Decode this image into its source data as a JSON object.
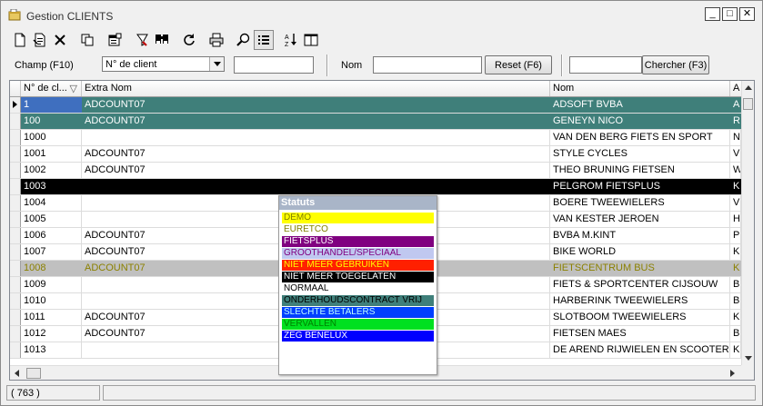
{
  "window": {
    "title": "Gestion CLIENTS",
    "controls": [
      "_",
      "□",
      "✕"
    ]
  },
  "toolbar": {
    "icons": [
      "new-document-icon",
      "edit-document-icon",
      "delete-icon",
      "copy-icon",
      "properties-icon",
      "filter-icon",
      "find-icon",
      "refresh-icon",
      "print-icon",
      "zoom-icon",
      "list-view-icon",
      "sort-icon",
      "columns-icon"
    ]
  },
  "search": {
    "champ_label": "Champ (F10)",
    "champ_value": "N° de client",
    "champ_input": "",
    "nom_label": "Nom",
    "nom_input": "",
    "reset_label": "Reset (F6)",
    "chercher_input": "",
    "chercher_label": "Chercher (F3)"
  },
  "grid": {
    "headers": [
      "N° de cl...",
      "Extra Nom",
      "Nom",
      "A"
    ],
    "sort_indicator": "▽",
    "rows": [
      {
        "num": "1",
        "extra": "ADCOUNT07",
        "nom": "ADSOFT BVBA",
        "a": "A",
        "style": "teal",
        "current": true
      },
      {
        "num": "100",
        "extra": "ADCOUNT07",
        "nom": "GENEYN NICO",
        "a": "R",
        "style": "teal",
        "current": false
      },
      {
        "num": "1000",
        "extra": "",
        "nom": "VAN DEN BERG FIETS EN SPORT",
        "a": "N",
        "style": "",
        "current": false
      },
      {
        "num": "1001",
        "extra": "ADCOUNT07",
        "nom": "STYLE CYCLES",
        "a": "V",
        "style": "",
        "current": false
      },
      {
        "num": "1002",
        "extra": "ADCOUNT07",
        "nom": "THEO BRUNING FIETSEN",
        "a": "W",
        "style": "",
        "current": false
      },
      {
        "num": "1003",
        "extra": "",
        "nom": "PELGROM FIETSPLUS",
        "a": "K",
        "style": "black",
        "current": false
      },
      {
        "num": "1004",
        "extra": "",
        "nom": "BOERE TWEEWIELERS",
        "a": "V",
        "style": "",
        "current": false
      },
      {
        "num": "1005",
        "extra": "",
        "nom": "VAN KESTER JEROEN",
        "a": "H",
        "style": "",
        "current": false
      },
      {
        "num": "1006",
        "extra": "ADCOUNT07",
        "nom": "BVBA M.KINT",
        "a": "P",
        "style": "",
        "current": false
      },
      {
        "num": "1007",
        "extra": "ADCOUNT07",
        "nom": "BIKE WORLD",
        "a": "K",
        "style": "",
        "current": false
      },
      {
        "num": "1008",
        "extra": "ADCOUNT07",
        "nom": "FIETSCENTRUM BUS",
        "a": "K",
        "style": "gray",
        "current": false
      },
      {
        "num": "1009",
        "extra": "",
        "nom": "FIETS & SPORTCENTER CIJSOUW",
        "a": "B",
        "style": "",
        "current": false
      },
      {
        "num": "1010",
        "extra": "",
        "nom": "HARBERINK TWEEWIELERS",
        "a": "B",
        "style": "",
        "current": false
      },
      {
        "num": "1011",
        "extra": "ADCOUNT07",
        "nom": "SLOTBOOM TWEEWIELERS",
        "a": "K",
        "style": "",
        "current": false
      },
      {
        "num": "1012",
        "extra": "ADCOUNT07",
        "nom": "FIETSEN MAES",
        "a": "B",
        "style": "",
        "current": false
      },
      {
        "num": "1013",
        "extra": "",
        "nom": "DE AREND RIJWIELEN EN SCOOTER",
        "a": "K",
        "style": "",
        "current": false
      }
    ]
  },
  "statuts": {
    "title": "Statuts",
    "items": [
      {
        "label": "DEMO",
        "bg": "#ffff00",
        "fg": "#808000"
      },
      {
        "label": "EURETCO",
        "bg": "#ffffff",
        "fg": "#808000"
      },
      {
        "label": "FIETSPLUS",
        "bg": "#800080",
        "fg": "#ffffff"
      },
      {
        "label": "GROOTHANDEL/SPECIAAL",
        "bg": "#c0c8f0",
        "fg": "#800080"
      },
      {
        "label": "NIET MEER GEBRUIKEN",
        "bg": "#ff2000",
        "fg": "#ffff00"
      },
      {
        "label": "NIET MEER TOEGELATEN",
        "bg": "#000000",
        "fg": "#ffffff"
      },
      {
        "label": "NORMAAL",
        "bg": "#ffffff",
        "fg": "#000000"
      },
      {
        "label": "ONDERHOUDSCONTRACT VRIJ",
        "bg": "#3f7f7a",
        "fg": "#000000"
      },
      {
        "label": "SLECHTE BETALERS",
        "bg": "#0040ff",
        "fg": "#c0ffff"
      },
      {
        "label": "VERVALLEN",
        "bg": "#00e020",
        "fg": "#008000"
      },
      {
        "label": "ZEG BENELUX",
        "bg": "#0000ff",
        "fg": "#ffffff"
      }
    ]
  },
  "status": {
    "count": "( 763 )"
  }
}
